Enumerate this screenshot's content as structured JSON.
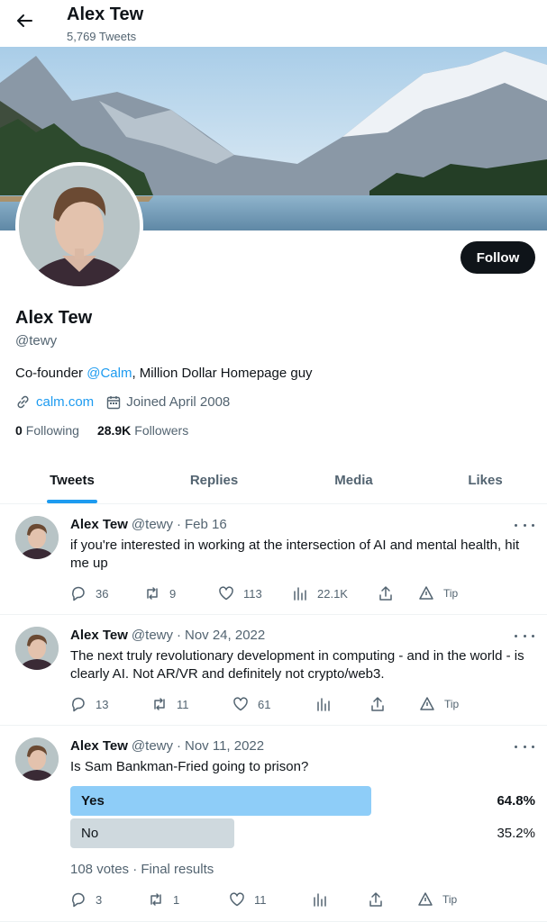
{
  "header": {
    "name": "Alex Tew",
    "tweet_count": "5,769 Tweets"
  },
  "profile": {
    "name": "Alex Tew",
    "handle": "@tewy",
    "bio_prefix": "Co-founder ",
    "bio_mention": "@Calm",
    "bio_suffix": ", Million Dollar Homepage guy",
    "link": "calm.com",
    "joined": "Joined April 2008",
    "following_count": "0",
    "following_label": "Following",
    "followers_count": "28.9K",
    "followers_label": "Followers",
    "follow_button": "Follow"
  },
  "tabs": [
    {
      "label": "Tweets",
      "active": true
    },
    {
      "label": "Replies",
      "active": false
    },
    {
      "label": "Media",
      "active": false
    },
    {
      "label": "Likes",
      "active": false
    }
  ],
  "tweets": [
    {
      "name": "Alex Tew",
      "handle": "@tewy",
      "sep": "·",
      "date": "Feb 16",
      "text": "if you're interested in working at the intersection of AI and mental health, hit me up",
      "replies": "36",
      "retweets": "9",
      "likes": "113",
      "views": "22.1K",
      "tip": "Tip"
    },
    {
      "name": "Alex Tew",
      "handle": "@tewy",
      "sep": "·",
      "date": "Nov 24, 2022",
      "text": "The next truly revolutionary development in computing - and in the world - is clearly AI. Not AR/VR and definitely not crypto/web3.",
      "replies": "13",
      "retweets": "11",
      "likes": "61",
      "views": "",
      "tip": "Tip"
    },
    {
      "name": "Alex Tew",
      "handle": "@tewy",
      "sep": "·",
      "date": "Nov 11, 2022",
      "text": "Is Sam Bankman-Fried going to prison?",
      "poll": [
        {
          "label": "Yes",
          "percent": "64.8%",
          "fraction": 0.648,
          "winner": true
        },
        {
          "label": "No",
          "percent": "35.2%",
          "fraction": 0.352,
          "winner": false
        }
      ],
      "poll_meta": "108 votes · Final results",
      "replies": "3",
      "retweets": "1",
      "likes": "11",
      "views": "",
      "tip": "Tip"
    }
  ],
  "colors": {
    "accent": "#1d9bf0",
    "poll_winner": "#8ecdf8",
    "poll_other": "#cfd9de",
    "text": "#0f1419",
    "muted": "#536471"
  }
}
